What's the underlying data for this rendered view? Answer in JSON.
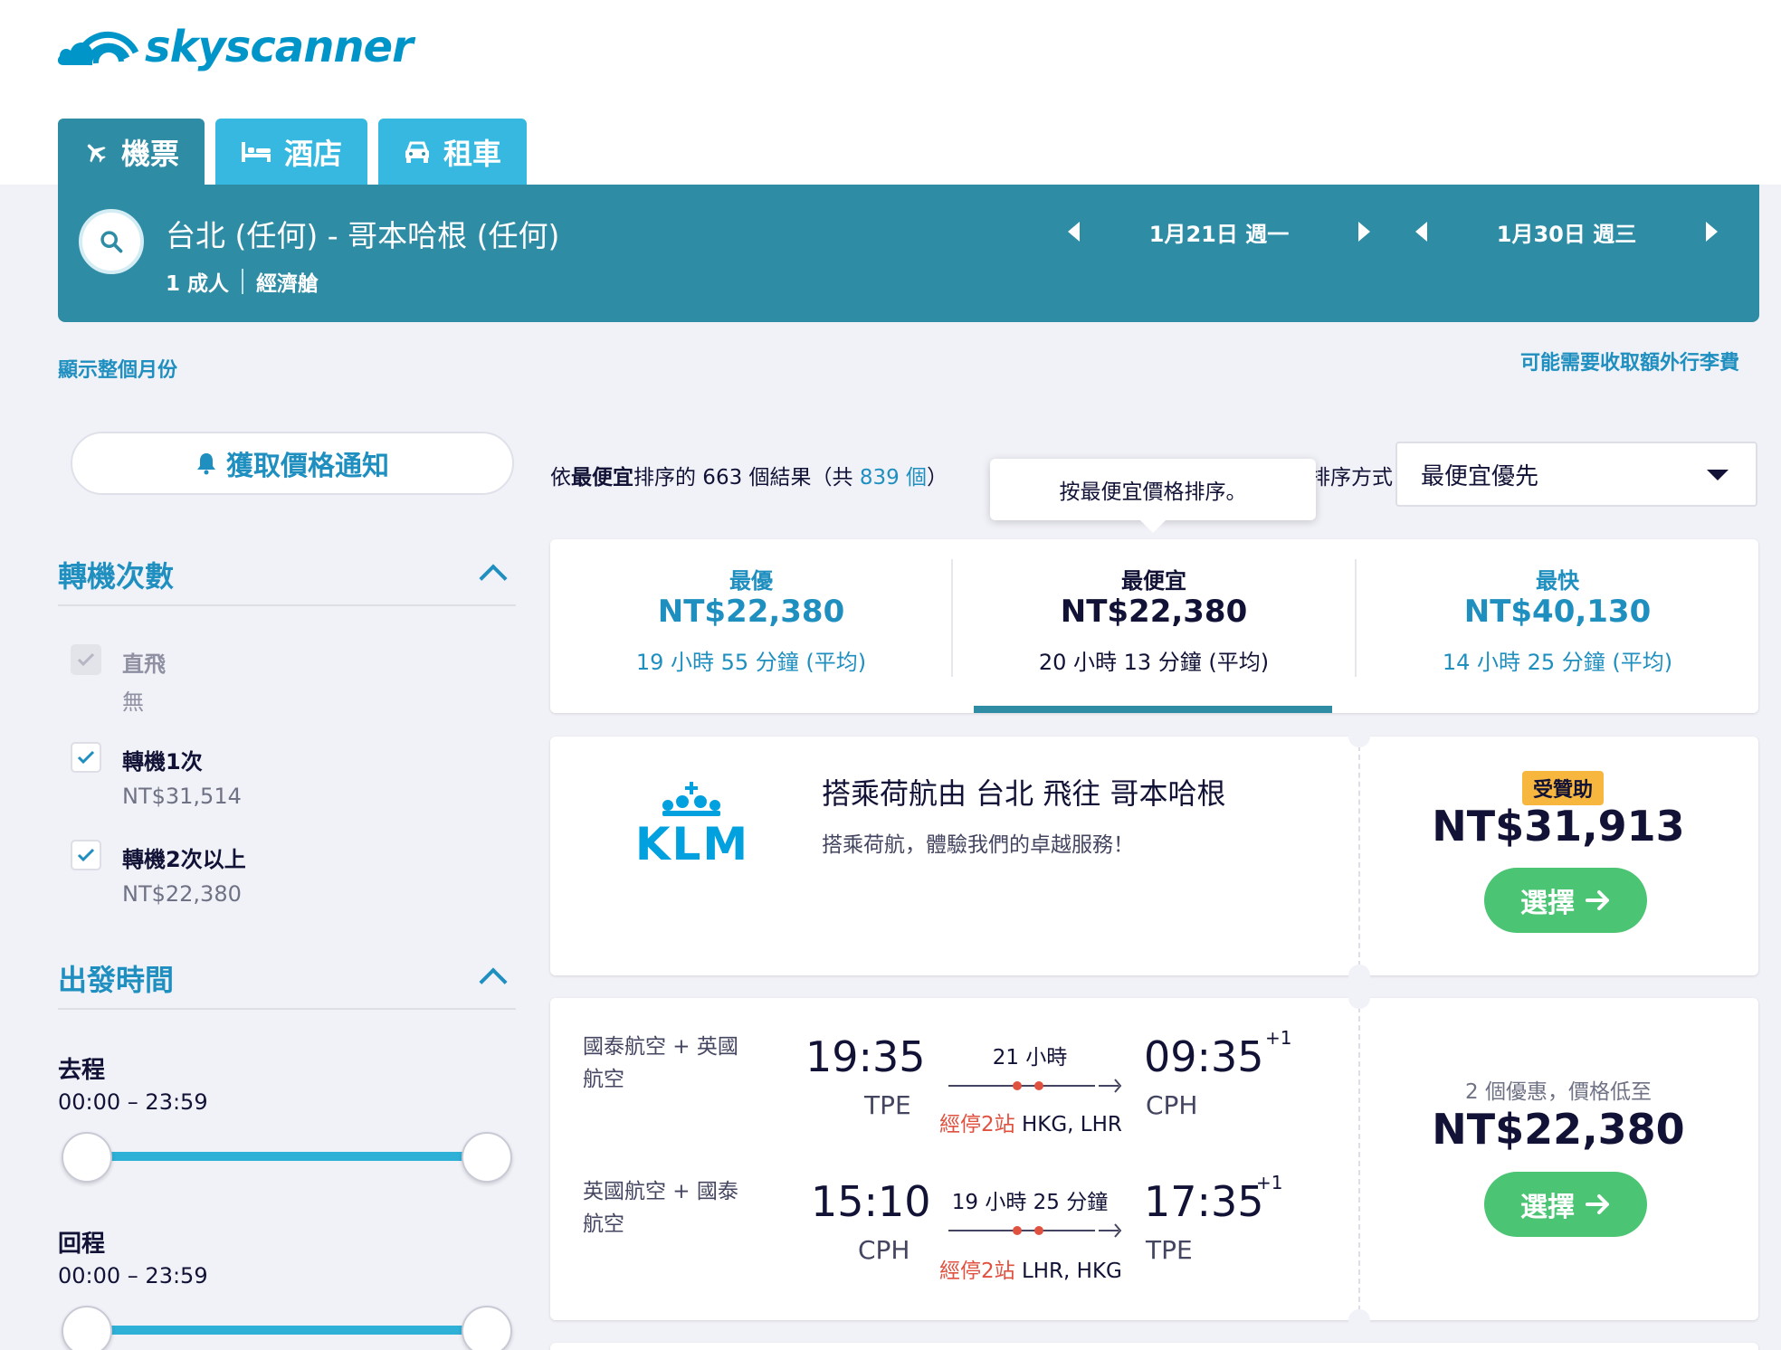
{
  "brand": {
    "name": "skyscanner",
    "color": "#0095c9"
  },
  "tabs": [
    {
      "label": "機票",
      "icon": "plane-icon",
      "active": true
    },
    {
      "label": "酒店",
      "icon": "bed-icon",
      "active": false
    },
    {
      "label": "租車",
      "icon": "car-icon",
      "active": false
    }
  ],
  "search": {
    "route": "台北 (任何) - 哥本哈根 (任何)",
    "passengers": "1 成人",
    "cabin": "經濟艙",
    "depart_date": "1月21日 週一",
    "return_date": "1月30日 週三"
  },
  "links": {
    "show_month": "顯示整個月份",
    "baggage_fee": "可能需要收取額外行李費"
  },
  "notify": {
    "label": "獲取價格通知"
  },
  "filters": {
    "stops": {
      "title": "轉機次數",
      "options": [
        {
          "label": "直飛",
          "sub": "無",
          "checked": true,
          "disabled": true
        },
        {
          "label": "轉機1次",
          "sub": "NT$31,514",
          "checked": true,
          "disabled": false
        },
        {
          "label": "轉機2次以上",
          "sub": "NT$22,380",
          "checked": true,
          "disabled": false
        }
      ]
    },
    "departure_time": {
      "title": "出發時間",
      "outbound_label": "去程",
      "outbound_range": "00:00 – 23:59",
      "return_label": "回程",
      "return_range": "00:00 – 23:59"
    }
  },
  "results": {
    "prefix": "依",
    "sort_word": "最便宜",
    "mid": "排序的 663 個結果（共 ",
    "total": "839 個",
    "suffix": "）",
    "sort_label": "排序方式",
    "sort_value": "最便宜優先",
    "tooltip": "按最便宜價格排序。"
  },
  "summary": [
    {
      "title": "最優",
      "price": "NT$22,380",
      "duration": "19 小時 55 分鐘 (平均)"
    },
    {
      "title": "最便宜",
      "price": "NT$22,380",
      "duration": "20 小時 13 分鐘 (平均)"
    },
    {
      "title": "最快",
      "price": "NT$40,130",
      "duration": "14 小時 25 分鐘 (平均)"
    }
  ],
  "ad": {
    "airline_logo": "KLM",
    "title": "搭乘荷航由 台北 飛往 哥本哈根",
    "subtitle": "搭乘荷航，體驗我們的卓越服務！",
    "badge": "受贊助",
    "price": "NT$31,913",
    "select": "選擇"
  },
  "itinerary": {
    "outbound": {
      "airline": "國泰航空 + 英國航空",
      "dep_time": "19:35",
      "dep_airport": "TPE",
      "duration": "21 小時",
      "stops_label": "經停2站",
      "stops_airports": "HKG, LHR",
      "arr_time": "09:35",
      "arr_airport": "CPH",
      "day_offset": "+1"
    },
    "return": {
      "airline": "英國航空 + 國泰航空",
      "dep_time": "15:10",
      "dep_airport": "CPH",
      "duration": "19 小時 25 分鐘",
      "stops_label": "經停2站",
      "stops_airports": "LHR, HKG",
      "arr_time": "17:35",
      "arr_airport": "TPE",
      "day_offset": "+1"
    },
    "deals": "2 個優惠，價格低至",
    "price": "NT$22,380",
    "select": "選擇"
  }
}
